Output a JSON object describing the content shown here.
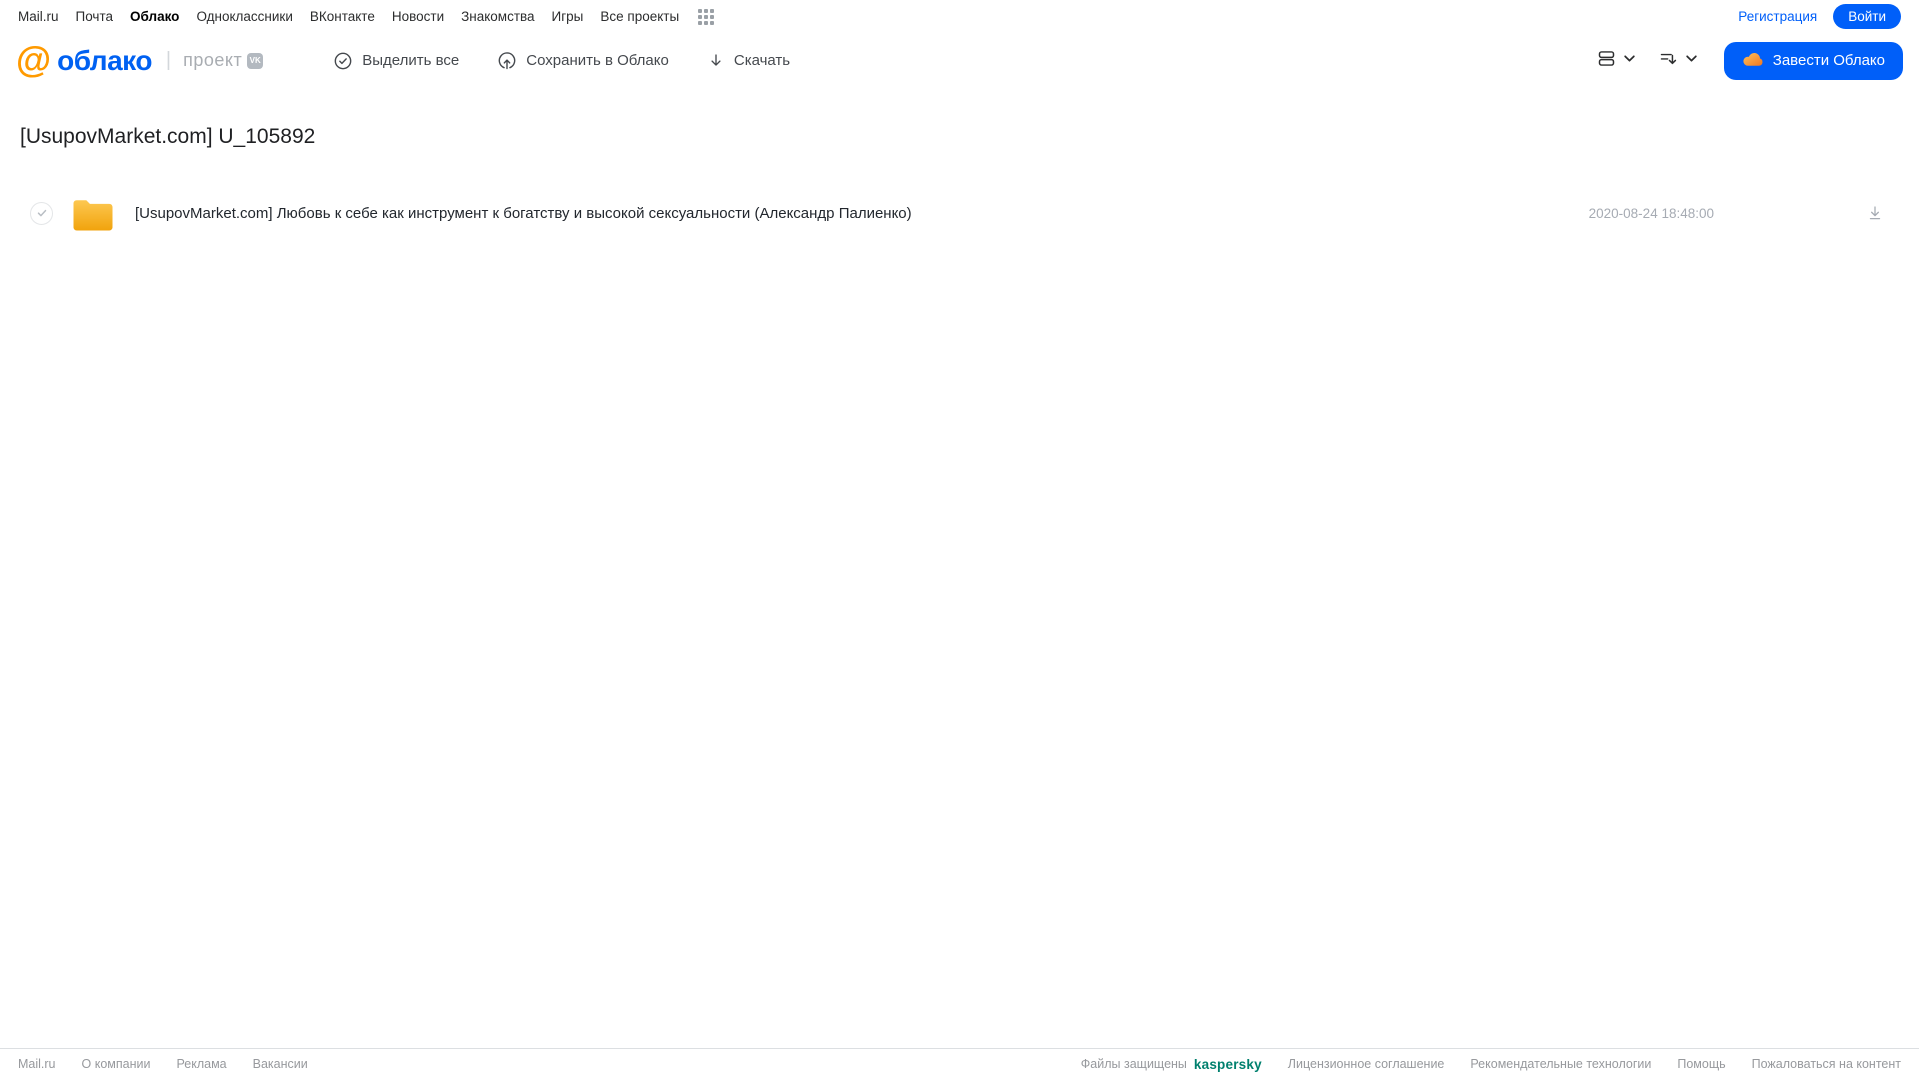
{
  "top_nav": {
    "links": [
      "Mail.ru",
      "Почта",
      "Облако",
      "Одноклассники",
      "ВКонтакте",
      "Новости",
      "Знакомства",
      "Игры",
      "Все проекты"
    ],
    "registration_label": "Регистрация",
    "login_label": "Войти"
  },
  "header": {
    "logo_text": "облако",
    "project_label": "проект",
    "toolbar": {
      "select_all": "Выделить все",
      "save_to_cloud": "Сохранить в Облако",
      "download": "Скачать"
    },
    "create_cloud_label": "Завести Облако"
  },
  "page": {
    "title": "[UsupovMarket.com] U_105892"
  },
  "files": [
    {
      "name": "[UsupovMarket.com] Любовь к себе как инструмент к богатству и высокой сексуальности (Александр Палиенко)",
      "date": "2020-08-24 18:48:00"
    }
  ],
  "footer": {
    "left_links": [
      "Mail.ru",
      "О компании",
      "Реклама",
      "Вакансии"
    ],
    "protected_label": "Файлы защищены",
    "kaspersky_label": "kaspersky",
    "right_links": [
      "Лицензионное соглашение",
      "Рекомендательные технологии",
      "Помощь",
      "Пожаловаться на контент"
    ]
  },
  "icons": {
    "apps_grid_icon": "3x3-dots",
    "check_circle_icon": "checkmark-in-circle",
    "cloud_upload_icon": "up-arrow-in-circle",
    "download_icon": "down-arrow",
    "view_mode_icon": "stacked-rows",
    "sort_icon": "lines-with-down-arrow",
    "chevron_down_icon": "⌄",
    "folder_icon": "yellow-folder",
    "cloud_icon": "orange-cloud",
    "vk_badge_icon": "VK",
    "at_logo_icon": "@"
  },
  "colors": {
    "accent_blue": "#005ff9",
    "logo_orange": "#ff9a00",
    "logo_blue": "#0061f2",
    "folder_top": "#fdc851",
    "folder_bottom": "#f1a30c",
    "kaspersky_teal": "#00806e",
    "text_dark": "#2c2d2e",
    "muted_gray": "#a6abb3"
  }
}
